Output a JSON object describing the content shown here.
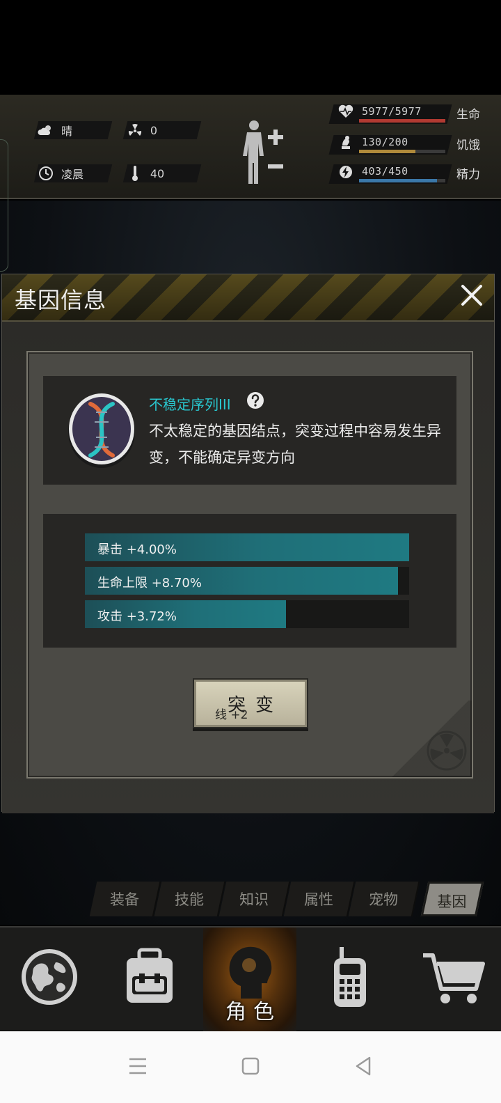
{
  "hud": {
    "weather": {
      "icon": "cloud-sun-icon",
      "text": "晴"
    },
    "radiation": {
      "icon": "radiation-icon",
      "value": "0"
    },
    "time": {
      "icon": "clock-icon",
      "text": "凌晨"
    },
    "temperature": {
      "icon": "thermometer-icon",
      "value": "40"
    },
    "health": {
      "icon": "heart-pulse-icon",
      "value": "5977/5977",
      "label": "生命",
      "fraction": 1.0,
      "color": "#b23a32"
    },
    "hunger": {
      "icon": "hand-food-icon",
      "value": "130/200",
      "label": "饥饿",
      "fraction": 0.65,
      "color": "#b08a3a"
    },
    "energy": {
      "icon": "energy-bolt-icon",
      "value": "403/450",
      "label": "精力",
      "fraction": 0.9,
      "color": "#3b78a8"
    }
  },
  "dialog": {
    "title": "基因信息",
    "gene": {
      "name": "不稳定序列III",
      "description": "不太稳定的基因结点，突变过程中容易发生异变，不能确定异变方向"
    },
    "stats": [
      {
        "label": "暴击 +4.00%",
        "fraction": 1.0
      },
      {
        "label": "生命上限 +8.70%",
        "fraction": 0.965
      },
      {
        "label": "攻击 +3.72%",
        "fraction": 0.62
      }
    ],
    "mutate_button": {
      "label": "突变",
      "cost": "线 +2"
    }
  },
  "subtabs": [
    {
      "label": "装备",
      "active": false
    },
    {
      "label": "技能",
      "active": false
    },
    {
      "label": "知识",
      "active": false
    },
    {
      "label": "属性",
      "active": false
    },
    {
      "label": "宠物",
      "active": false
    },
    {
      "label": "基因",
      "active": true
    }
  ],
  "bottom_nav": {
    "active_label": "角色",
    "items": [
      "globe-icon",
      "backpack-icon",
      "character-icon",
      "radio-icon",
      "cart-icon"
    ]
  },
  "accent": "#29c7cf"
}
